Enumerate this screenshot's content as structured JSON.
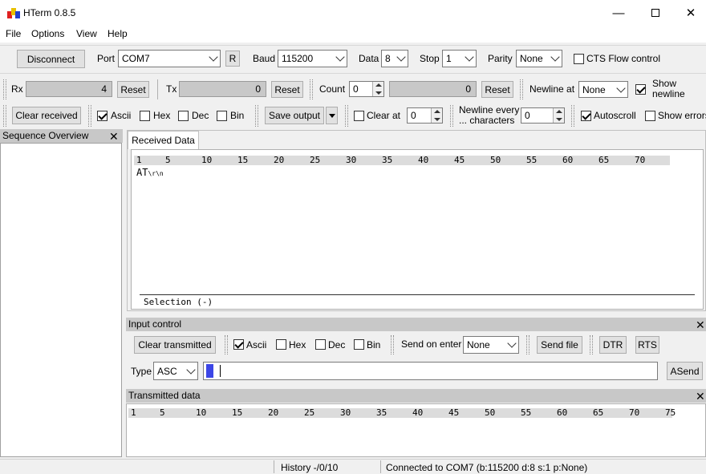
{
  "window": {
    "title": "HTerm 0.8.5"
  },
  "menu": [
    "File",
    "Options",
    "View",
    "Help"
  ],
  "connection": {
    "disconnect_label": "Disconnect",
    "port_label": "Port",
    "port_value": "COM7",
    "r_label": "R",
    "baud_label": "Baud",
    "baud_value": "115200",
    "data_label": "Data",
    "data_value": "8",
    "stop_label": "Stop",
    "stop_value": "1",
    "parity_label": "Parity",
    "parity_value": "None",
    "cts_label": "CTS Flow control"
  },
  "counters": {
    "rx_label": "Rx",
    "rx_value": "4",
    "rx_reset": "Reset",
    "tx_label": "Tx",
    "tx_value": "0",
    "tx_reset": "Reset",
    "count_label": "Count",
    "count_value": "0",
    "count_display": "0",
    "count_reset": "Reset",
    "newline_at_label": "Newline at",
    "newline_at_value": "None",
    "show_newline_label_1": "Show",
    "show_newline_label_2": "newline"
  },
  "rx_options": {
    "clear_received": "Clear received",
    "ascii": "Ascii",
    "hex": "Hex",
    "dec": "Dec",
    "bin": "Bin",
    "save_output": "Save output",
    "clear_at_label": "Clear at",
    "clear_at_value": "0",
    "newline_every_1": "Newline every",
    "newline_every_2": "... characters",
    "newline_every_value": "0",
    "autoscroll": "Autoscroll",
    "show_errors": "Show errors"
  },
  "sequence": {
    "title": "Sequence Overview"
  },
  "received": {
    "tab": "Received Data",
    "ruler": [
      "1",
      "5",
      "10",
      "15",
      "20",
      "25",
      "30",
      "35",
      "40",
      "45",
      "50",
      "55",
      "60",
      "65",
      "70"
    ],
    "data_text": "AT",
    "data_suffix": "\\r\\n",
    "selection": "Selection (-)"
  },
  "input_control": {
    "title": "Input control",
    "clear_transmitted": "Clear transmitted",
    "ascii": "Ascii",
    "hex": "Hex",
    "dec": "Dec",
    "bin": "Bin",
    "send_on_enter_label": "Send on enter",
    "send_on_enter_value": "None",
    "send_file": "Send file",
    "dtr": "DTR",
    "rts": "RTS",
    "type_label": "Type",
    "type_value": "ASC",
    "input_value": "",
    "asend": "ASend"
  },
  "transmitted": {
    "title": "Transmitted data",
    "ruler": [
      "1",
      "5",
      "10",
      "15",
      "20",
      "25",
      "30",
      "35",
      "40",
      "45",
      "50",
      "55",
      "60",
      "65",
      "70",
      "75"
    ]
  },
  "status": {
    "history": "History -/0/10",
    "connection": "Connected to COM7 (b:115200 d:8 s:1 p:None)"
  },
  "colors": {
    "accent_blue": "#3c46e6",
    "panel_header": "#c8c8c8"
  }
}
